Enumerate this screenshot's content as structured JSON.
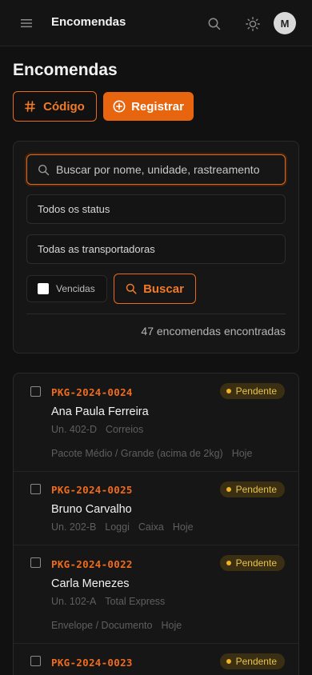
{
  "header": {
    "title": "Encomendas",
    "avatar_initial": "M",
    "icons": [
      "menu-icon",
      "search-icon",
      "sun-icon"
    ]
  },
  "page": {
    "title": "Encomendas",
    "codigo_label": "Código",
    "registrar_label": "Registrar"
  },
  "filters": {
    "search_placeholder": "Buscar por nome, unidade, rastreamento",
    "status_selected": "Todos os status",
    "carrier_selected": "Todas as transportadoras",
    "vencidas_label": "Vencidas",
    "buscar_label": "Buscar",
    "count_text": "47 encomendas encontradas"
  },
  "colors": {
    "accent": "#e8650f",
    "badge_pending_bg": "#3a2f12",
    "badge_pending_text": "#e8c24a",
    "background": "#111111"
  },
  "packages": [
    {
      "code": "PKG-2024-0024",
      "status": "Pendente",
      "name": "Ana Paula Ferreira",
      "unit": "Un. 402-D",
      "carrier": "Correios",
      "size": "Pacote Médio / Grande (acima de 2kg)",
      "date": "Hoje"
    },
    {
      "code": "PKG-2024-0025",
      "status": "Pendente",
      "name": "Bruno Carvalho",
      "unit": "Un. 202-B",
      "carrier": "Loggi",
      "size": "Caixa",
      "date": "Hoje"
    },
    {
      "code": "PKG-2024-0022",
      "status": "Pendente",
      "name": "Carla Menezes",
      "unit": "Un. 102-A",
      "carrier": "Total Express",
      "size": "Envelope / Documento",
      "date": "Hoje"
    },
    {
      "code": "PKG-2024-0023",
      "status": "Pendente"
    }
  ]
}
